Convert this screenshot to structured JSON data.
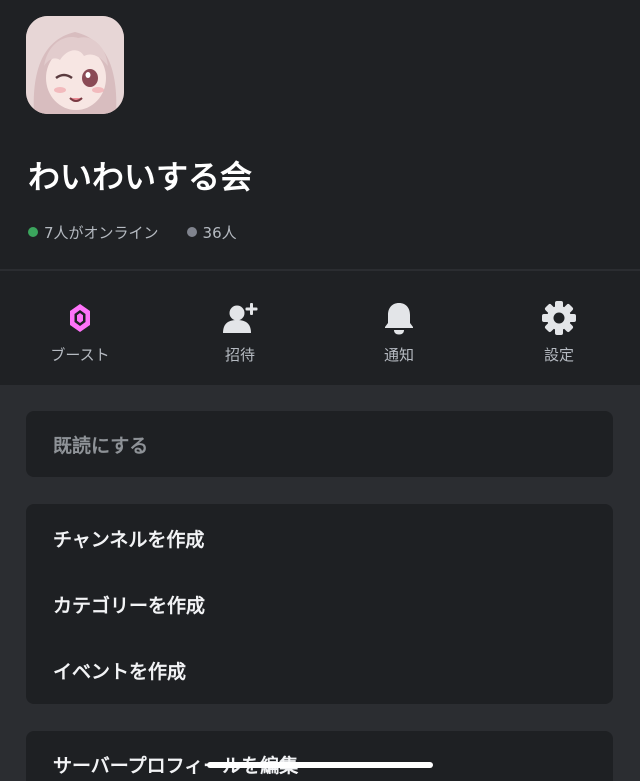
{
  "server": {
    "name": "わいわいする会",
    "online_label": "7人がオンライン",
    "members_label": "36人"
  },
  "colors": {
    "online": "#3ba55d",
    "offline": "#80848e",
    "boost": "#ff73fa"
  },
  "actions": [
    {
      "label": "ブースト",
      "icon": "boost-gem-icon"
    },
    {
      "label": "招待",
      "icon": "add-person-icon"
    },
    {
      "label": "通知",
      "icon": "bell-icon"
    },
    {
      "label": "設定",
      "icon": "gear-icon"
    }
  ],
  "menu": {
    "mark_read": "既読にする",
    "create_channel": "チャンネルを作成",
    "create_category": "カテゴリーを作成",
    "create_event": "イベントを作成",
    "edit_server_profile": "サーバープロフィールを編集"
  }
}
